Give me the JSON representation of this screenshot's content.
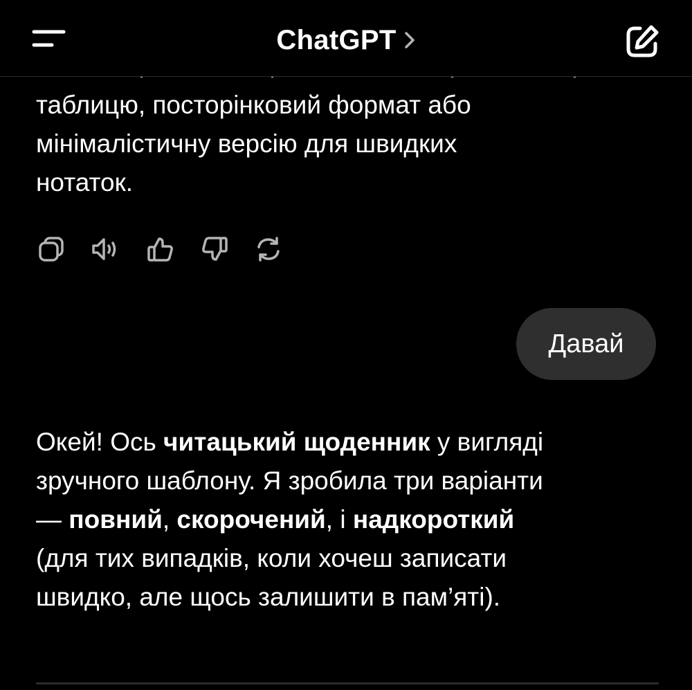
{
  "header": {
    "title": "ChatGPT",
    "chevron": "chevron-right-icon",
    "menu_icon": "menu-icon",
    "new_chat_icon": "new-chat-icon"
  },
  "messages": {
    "assistant_top": {
      "lines": [
        "таблицю, посторінковий формат або",
        "мінімалістичну версію для швидких",
        "нотаток."
      ]
    },
    "actions": [
      {
        "name": "copy-icon"
      },
      {
        "name": "read-aloud-icon"
      },
      {
        "name": "thumbs-up-icon"
      },
      {
        "name": "thumbs-down-icon"
      },
      {
        "name": "regenerate-icon"
      }
    ],
    "user": {
      "text": "Давай"
    },
    "assistant_bottom": {
      "line1": {
        "a": "Окей! Ось ",
        "b": "читацький щоденник",
        "c": " у вигляді"
      },
      "line2": "зручного шаблону. Я зробила три варіанти",
      "line3": {
        "a": "— ",
        "b1": "повний",
        "s1": ", ",
        "b2": "скорочений",
        "s2": ", і ",
        "b3": "надкороткий"
      },
      "line4": "(для тих випадків, коли хочеш записати",
      "line5": "швидко, але щось залишити в пам’яті)."
    }
  },
  "colors": {
    "background": "#000000",
    "text": "#ffffff",
    "icon": "#b4b4b4",
    "user_bubble": "#2f2f2f"
  }
}
